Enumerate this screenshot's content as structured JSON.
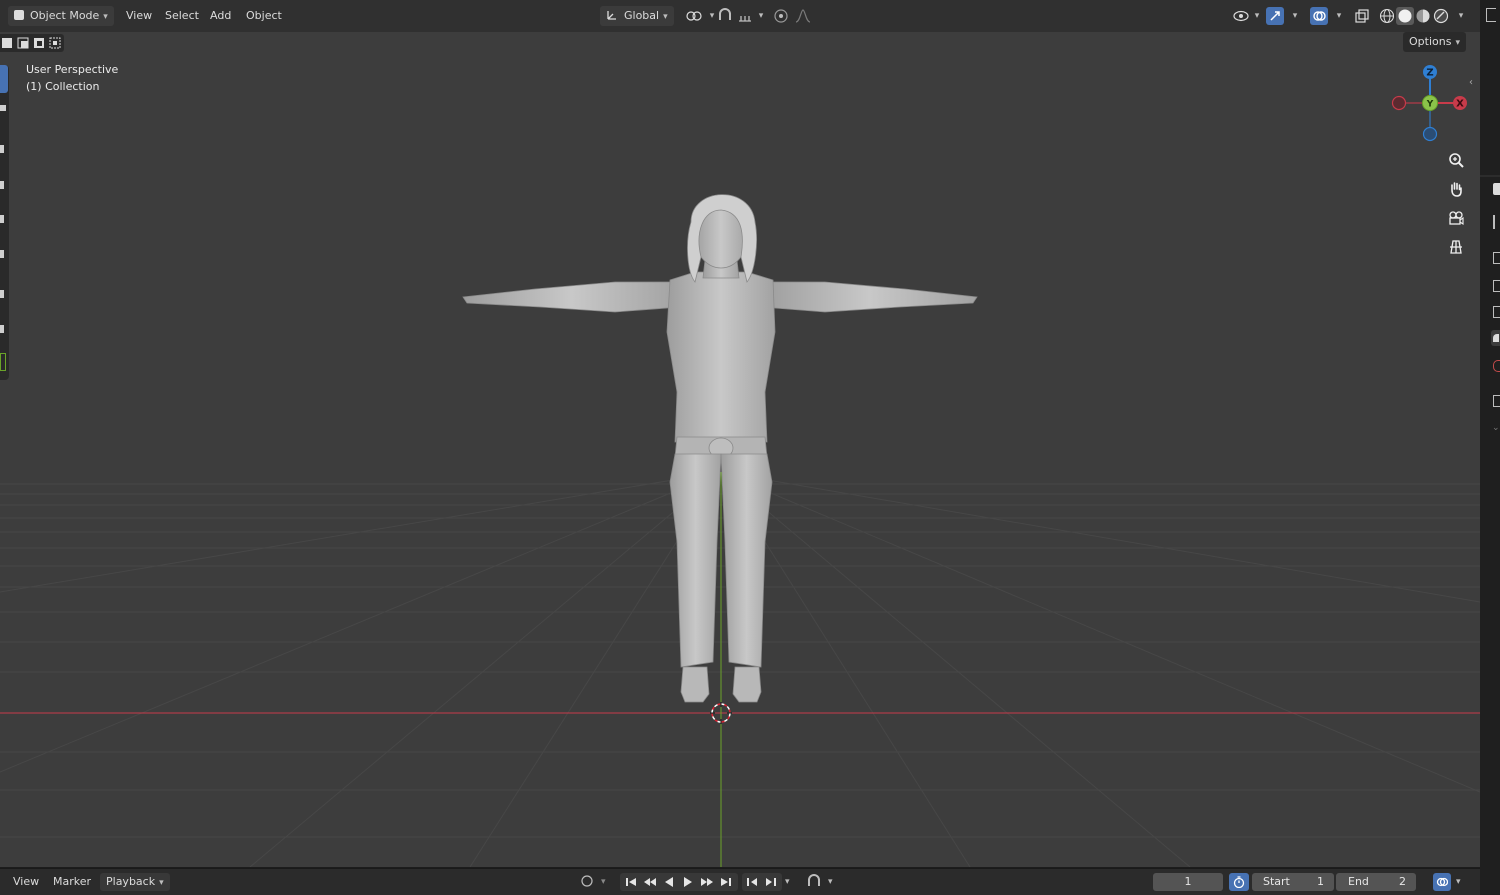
{
  "header": {
    "mode_label": "Object Mode",
    "menu": [
      "View",
      "Select",
      "Add",
      "Object"
    ],
    "orientation_label": "Global",
    "options_label": "Options"
  },
  "viewport": {
    "view_name": "User Perspective",
    "collection_label": "(1) Collection",
    "gizmo": {
      "z": "Z",
      "y": "Y",
      "x": "X"
    }
  },
  "timeline": {
    "menu": [
      "View",
      "Marker",
      "Playback"
    ],
    "current_frame": "1",
    "start_label": "Start",
    "start_value": "1",
    "end_label": "End",
    "end_value": "2"
  },
  "icons": {
    "header": [
      "object-mode-icon",
      "orientation-icon",
      "pivot-icon",
      "snap-icon",
      "snap-increment-icon",
      "proportional-edit-icon",
      "falloff-icon",
      "visibility-icon",
      "gizmo-icon",
      "overlay-icon",
      "xray-icon",
      "wireframe-shading-icon",
      "solid-shading-icon",
      "material-shading-icon",
      "rendered-shading-icon"
    ],
    "navigation": [
      "zoom-icon",
      "hand-pan-icon",
      "camera-icon",
      "grid-view-icon"
    ],
    "playback": [
      "jump-start-icon",
      "prev-keyframe-icon",
      "play-reverse-icon",
      "play-icon",
      "next-keyframe-icon",
      "jump-end-icon"
    ]
  },
  "colors": {
    "x_axis": "#c83b4a",
    "y_axis": "#6aa329",
    "z_axis": "#2f7fd3",
    "viewport_bg": "#3d3d3d",
    "header_bg": "#303030",
    "accent": "#4772b3"
  }
}
